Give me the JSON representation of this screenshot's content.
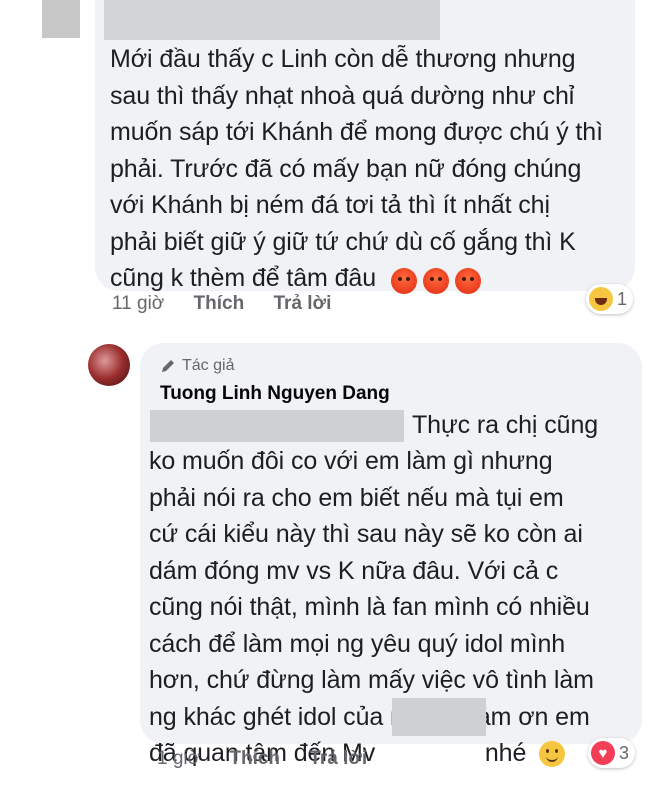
{
  "comment1": {
    "lines": [
      "Mới đầu thấy c Linh còn dễ thương nhưng",
      "sau thì thấy nhạt nhoà quá dường như chỉ",
      "muốn sáp tới Khánh để mong được chú ý thì",
      "phải. Trước đã có mấy bạn nữ đóng chúng",
      "với Khánh bị ném đá tơi tả thì ít nhất chị",
      "phải biết giữ ý giữ tứ chứ dù cố gắng thì K",
      "cũng k thèm để tâm đâu"
    ],
    "emojis": [
      "angry-face-icon",
      "angry-face-icon",
      "angry-face-icon"
    ],
    "time": "11 giờ",
    "like_label": "Thích",
    "reply_label": "Trả lời",
    "reaction_count": "1"
  },
  "reply": {
    "author_tag": "Tác giả",
    "author_name": "Tuong Linh Nguyen Dang",
    "first_line": "Thực ra chị cũng",
    "lines": [
      "ko muốn đôi co với em làm gì nhưng",
      "phải nói ra cho em biết nếu mà tụi em",
      "cứ cái kiểu này thì sau này sẽ ko còn ai",
      "dám đóng mv vs K nữa đâu. Với cả c",
      "cũng nói thật, mình là fan mình có nhiều",
      "cách để làm mọi ng yêu quý idol mình",
      "hơn, chứ đừng làm mấy việc vô tình làm",
      "ng khác ghét idol của mình. Cảm ơn em"
    ],
    "last_line_start": "đã quan tâm đến Mv",
    "last_line_end": "nhé",
    "time": "1 giờ",
    "like_label": "Thích",
    "reply_label": "Trả lời",
    "reaction_count": "3"
  },
  "colors": {
    "bubble": "#f0f2f5",
    "meta": "#65676b",
    "love": "#f33e58",
    "haha": "#f7c640"
  }
}
